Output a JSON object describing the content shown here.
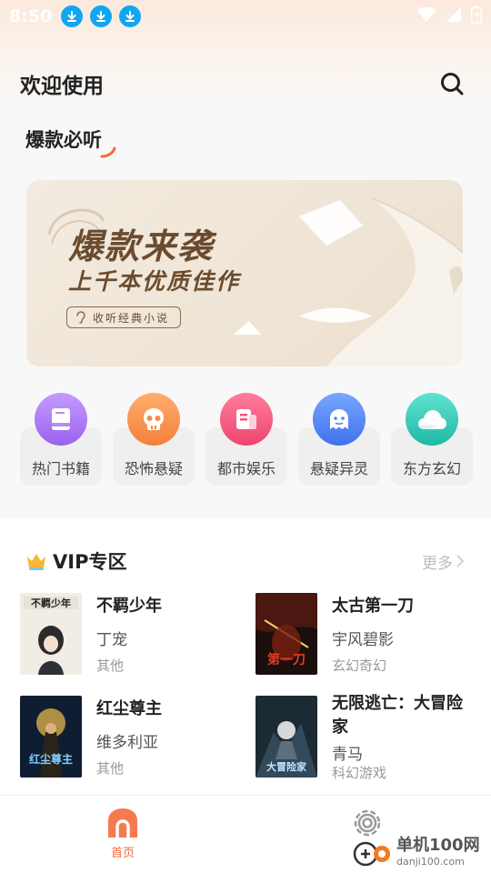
{
  "status_bar": {
    "time": "8:50"
  },
  "header": {
    "title": "欢迎使用"
  },
  "hot_section": {
    "title": "爆款必听"
  },
  "banner": {
    "title": "爆款来袭",
    "subtitle": "上千本优质佳作",
    "button_label": "收听经典小说"
  },
  "categories": [
    {
      "label": "热门书籍",
      "color": "#a06cf0",
      "icon": "book-icon"
    },
    {
      "label": "恐怖悬疑",
      "color": "#f58a45",
      "icon": "skull-icon"
    },
    {
      "label": "都市娱乐",
      "color": "#f2547a",
      "icon": "newspaper-icon"
    },
    {
      "label": "悬疑异灵",
      "color": "#4f83f5",
      "icon": "ghost-icon"
    },
    {
      "label": "东方玄幻",
      "color": "#2ec7b4",
      "icon": "cloud-icon"
    }
  ],
  "vip": {
    "title": "VIP专区",
    "more": "更多",
    "books": [
      {
        "title": "不羁少年",
        "author": "丁宠",
        "genre": "其他"
      },
      {
        "title": "太古第一刀",
        "author": "宇风碧影",
        "genre": "玄幻奇幻"
      },
      {
        "title": "红尘尊主",
        "author": "维多利亚",
        "genre": "其他"
      },
      {
        "title": "无限逃亡：大冒险家",
        "author": "青马",
        "genre": "科幻游戏"
      }
    ]
  },
  "bottom_nav": {
    "home_label": "首页"
  },
  "watermark": {
    "line1": "单机100网",
    "line2": "danji100.com"
  },
  "colors": {
    "accent": "#f26a3d",
    "download_badge": "#12a6f0"
  }
}
